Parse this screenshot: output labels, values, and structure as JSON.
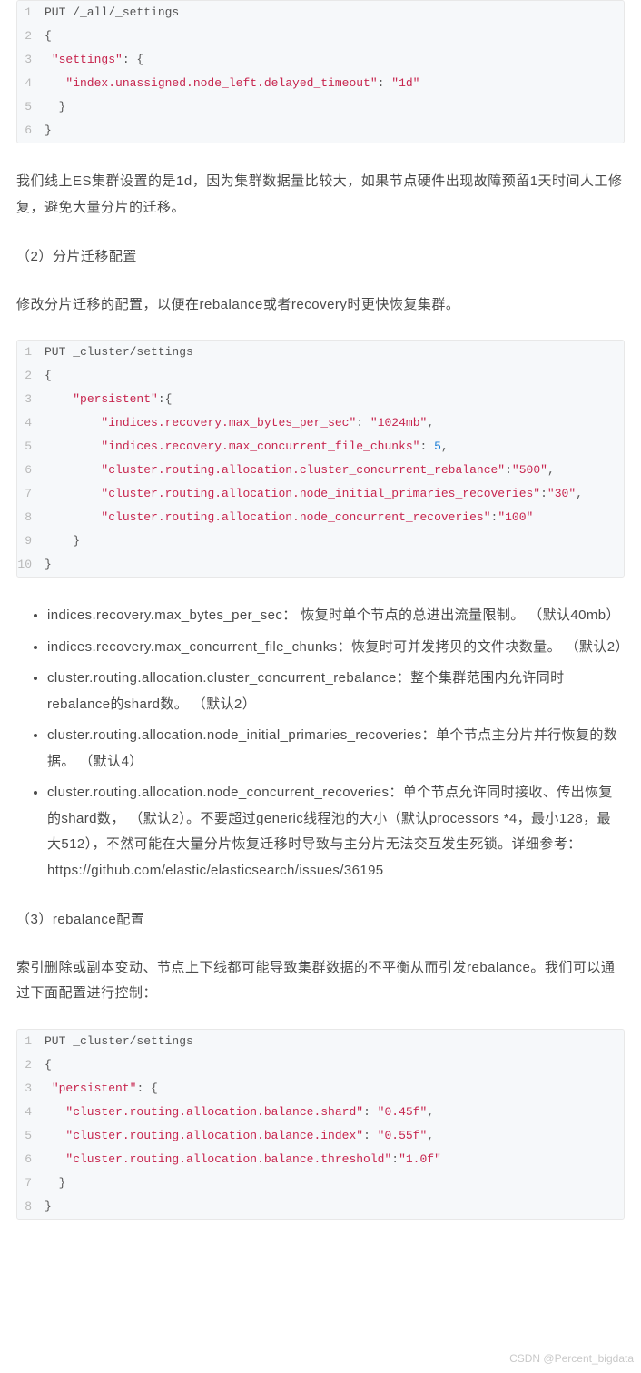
{
  "code1": {
    "lines": [
      [
        {
          "t": "PUT /_all/_settings",
          "c": ""
        }
      ],
      [
        {
          "t": "{",
          "c": ""
        }
      ],
      [
        {
          "t": " ",
          "c": ""
        },
        {
          "t": "\"settings\"",
          "c": "tok-str"
        },
        {
          "t": ": {",
          "c": ""
        }
      ],
      [
        {
          "t": "   ",
          "c": ""
        },
        {
          "t": "\"index.unassigned.node_left.delayed_timeout\"",
          "c": "tok-str"
        },
        {
          "t": ": ",
          "c": ""
        },
        {
          "t": "\"1d\"",
          "c": "tok-str"
        }
      ],
      [
        {
          "t": "  }",
          "c": ""
        }
      ],
      [
        {
          "t": "}",
          "c": ""
        }
      ]
    ]
  },
  "para1": "我们线上ES集群设置的是1d，因为集群数据量比较大，如果节点硬件出现故障预留1天时间人工修复，避免大量分片的迁移。",
  "sub1": "（2）分片迁移配置",
  "para2": "修改分片迁移的配置，以便在rebalance或者recovery时更快恢复集群。",
  "code2": {
    "lines": [
      [
        {
          "t": "PUT _cluster/settings",
          "c": ""
        }
      ],
      [
        {
          "t": "{",
          "c": ""
        }
      ],
      [
        {
          "t": "    ",
          "c": ""
        },
        {
          "t": "\"persistent\"",
          "c": "tok-str"
        },
        {
          "t": ":{",
          "c": ""
        }
      ],
      [
        {
          "t": "        ",
          "c": ""
        },
        {
          "t": "\"indices.recovery.max_bytes_per_sec\"",
          "c": "tok-str"
        },
        {
          "t": ": ",
          "c": ""
        },
        {
          "t": "\"1024mb\"",
          "c": "tok-str"
        },
        {
          "t": ",",
          "c": ""
        }
      ],
      [
        {
          "t": "        ",
          "c": ""
        },
        {
          "t": "\"indices.recovery.max_concurrent_file_chunks\"",
          "c": "tok-str"
        },
        {
          "t": ": ",
          "c": ""
        },
        {
          "t": "5",
          "c": "tok-num"
        },
        {
          "t": ",",
          "c": ""
        }
      ],
      [
        {
          "t": "        ",
          "c": ""
        },
        {
          "t": "\"cluster.routing.allocation.cluster_concurrent_rebalance\"",
          "c": "tok-str"
        },
        {
          "t": ":",
          "c": ""
        },
        {
          "t": "\"500\"",
          "c": "tok-str"
        },
        {
          "t": ",",
          "c": ""
        }
      ],
      [
        {
          "t": "        ",
          "c": ""
        },
        {
          "t": "\"cluster.routing.allocation.node_initial_primaries_recoveries\"",
          "c": "tok-str"
        },
        {
          "t": ":",
          "c": ""
        },
        {
          "t": "\"30\"",
          "c": "tok-str"
        },
        {
          "t": ",",
          "c": ""
        }
      ],
      [
        {
          "t": "        ",
          "c": ""
        },
        {
          "t": "\"cluster.routing.allocation.node_concurrent_recoveries\"",
          "c": "tok-str"
        },
        {
          "t": ":",
          "c": ""
        },
        {
          "t": "\"100\"",
          "c": "tok-str"
        }
      ],
      [
        {
          "t": "    }",
          "c": ""
        }
      ],
      [
        {
          "t": "}",
          "c": ""
        }
      ]
    ]
  },
  "bullets": [
    "indices.recovery.max_bytes_per_sec： 恢复时单个节点的总进出流量限制。 （默认40mb）",
    "indices.recovery.max_concurrent_file_chunks：恢复时可并发拷贝的文件块数量。 （默认2）",
    "cluster.routing.allocation.cluster_concurrent_rebalance：整个集群范围内允许同时rebalance的shard数。 （默认2）",
    "cluster.routing.allocation.node_initial_primaries_recoveries：单个节点主分片并行恢复的数据。 （默认4）",
    "cluster.routing.allocation.node_concurrent_recoveries：单个节点允许同时接收、传出恢复的shard数， （默认2）。不要超过generic线程池的大小（默认processors *4，最小128，最大512），不然可能在大量分片恢复迁移时导致与主分片无法交互发生死锁。详细参考：https://github.com/elastic/elasticsearch/issues/36195"
  ],
  "sub2": "（3）rebalance配置",
  "para3": "索引删除或副本变动、节点上下线都可能导致集群数据的不平衡从而引发rebalance。我们可以通过下面配置进行控制：",
  "code3": {
    "lines": [
      [
        {
          "t": "PUT _cluster/settings",
          "c": ""
        }
      ],
      [
        {
          "t": "{",
          "c": ""
        }
      ],
      [
        {
          "t": " ",
          "c": ""
        },
        {
          "t": "\"persistent\"",
          "c": "tok-str"
        },
        {
          "t": ": {",
          "c": ""
        }
      ],
      [
        {
          "t": "   ",
          "c": ""
        },
        {
          "t": "\"cluster.routing.allocation.balance.shard\"",
          "c": "tok-str"
        },
        {
          "t": ": ",
          "c": ""
        },
        {
          "t": "\"0.45f\"",
          "c": "tok-str"
        },
        {
          "t": ",",
          "c": ""
        }
      ],
      [
        {
          "t": "   ",
          "c": ""
        },
        {
          "t": "\"cluster.routing.allocation.balance.index\"",
          "c": "tok-str"
        },
        {
          "t": ": ",
          "c": ""
        },
        {
          "t": "\"0.55f\"",
          "c": "tok-str"
        },
        {
          "t": ",",
          "c": ""
        }
      ],
      [
        {
          "t": "   ",
          "c": ""
        },
        {
          "t": "\"cluster.routing.allocation.balance.threshold\"",
          "c": "tok-str"
        },
        {
          "t": ":",
          "c": ""
        },
        {
          "t": "\"1.0f\"",
          "c": "tok-str"
        }
      ],
      [
        {
          "t": "  }",
          "c": ""
        }
      ],
      [
        {
          "t": "}",
          "c": ""
        }
      ]
    ]
  },
  "watermark": "CSDN @Percent_bigdata"
}
